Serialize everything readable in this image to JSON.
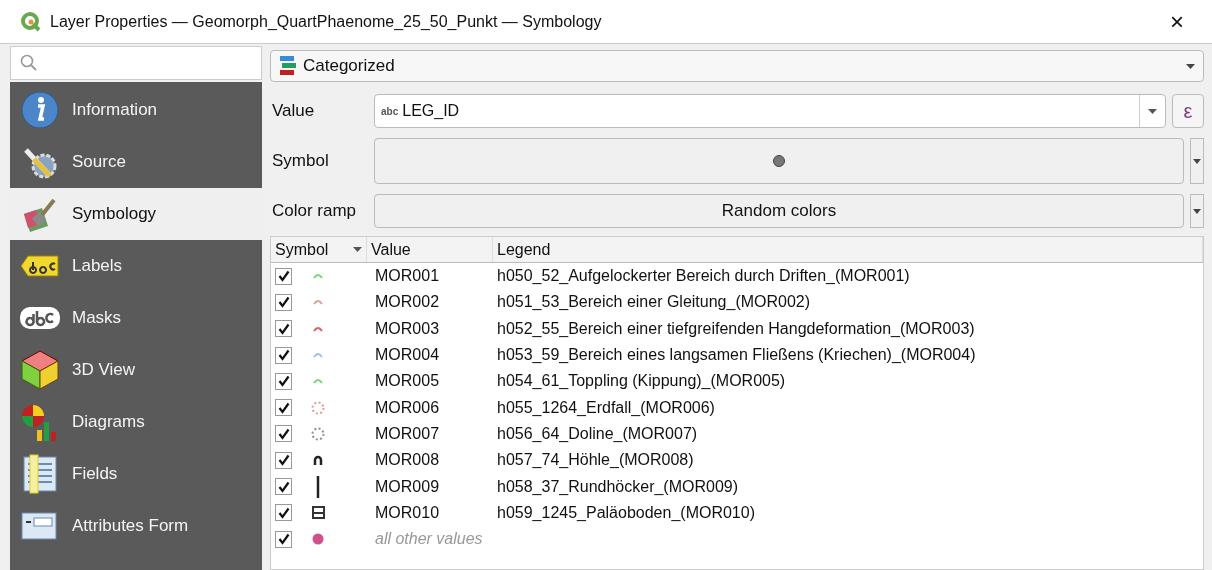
{
  "window": {
    "title": "Layer Properties — Geomorph_QuartPhaenome_25_50_Punkt — Symbology",
    "close": "×"
  },
  "sidebar": {
    "items": [
      {
        "label": "Information",
        "selected": false
      },
      {
        "label": "Source",
        "selected": false
      },
      {
        "label": "Symbology",
        "selected": true
      },
      {
        "label": "Labels",
        "selected": false
      },
      {
        "label": "Masks",
        "selected": false
      },
      {
        "label": "3D View",
        "selected": false
      },
      {
        "label": "Diagrams",
        "selected": false
      },
      {
        "label": "Fields",
        "selected": false
      },
      {
        "label": "Attributes Form",
        "selected": false
      }
    ]
  },
  "renderer": {
    "value": "Categorized"
  },
  "value_field": {
    "label": "Value",
    "type_badge": "abc",
    "value": "LEG_ID",
    "expression": "ε"
  },
  "symbol": {
    "label": "Symbol"
  },
  "color_ramp": {
    "label": "Color ramp",
    "value": "Random colors"
  },
  "table": {
    "columns": [
      "Symbol",
      "Value",
      "Legend"
    ],
    "rows": [
      {
        "checked": true,
        "kind": "arc",
        "color": "#7fd67f",
        "value": "MOR001",
        "legend": "h050_52_Aufgelockerter Bereich durch Driften_(MOR001)"
      },
      {
        "checked": true,
        "kind": "arc",
        "color": "#d9a5a0",
        "value": "MOR002",
        "legend": "h051_53_Bereich einer Gleitung_(MOR002)"
      },
      {
        "checked": true,
        "kind": "arc",
        "color": "#e06060",
        "value": "MOR003",
        "legend": "h052_55_Bereich einer tiefgreifenden Hangdeformation_(MOR003)"
      },
      {
        "checked": true,
        "kind": "arc",
        "color": "#9cc4e8",
        "value": "MOR004",
        "legend": "h053_59_Bereich eines langsamen Fließens (Kriechen)_(MOR004)"
      },
      {
        "checked": true,
        "kind": "arc",
        "color": "#7fd67f",
        "value": "MOR005",
        "legend": "h054_61_Toppling (Kippung)_(MOR005)"
      },
      {
        "checked": true,
        "kind": "ring",
        "color": "#e0a090",
        "value": "MOR006",
        "legend": "h055_1264_Erdfall_(MOR006)"
      },
      {
        "checked": true,
        "kind": "ring",
        "color": "#909090",
        "value": "MOR007",
        "legend": "h056_64_Doline_(MOR007)"
      },
      {
        "checked": true,
        "kind": "cave",
        "color": "#222222",
        "value": "MOR008",
        "legend": "h057_74_Höhle_(MOR008)"
      },
      {
        "checked": true,
        "kind": "pin",
        "color": "#222222",
        "value": "MOR009",
        "legend": "h058_37_Rundhöcker_(MOR009)"
      },
      {
        "checked": true,
        "kind": "box",
        "color": "#333333",
        "value": "MOR010",
        "legend": "h059_1245_Paläoboden_(MOR010)"
      },
      {
        "checked": true,
        "kind": "dot",
        "color": "#d0508a",
        "value": "all other values"
      }
    ]
  }
}
